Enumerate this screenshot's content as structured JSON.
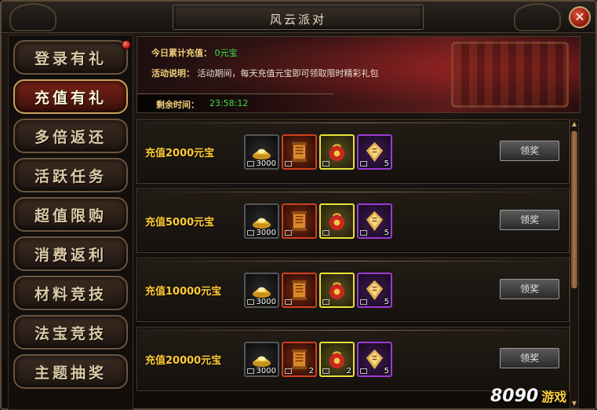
{
  "window": {
    "title": "风云派对",
    "close_symbol": "✕"
  },
  "menu": {
    "items": [
      {
        "label": "登录有礼",
        "active": false,
        "has_dot": true
      },
      {
        "label": "充值有礼",
        "active": true,
        "has_dot": false
      },
      {
        "label": "多倍返还",
        "active": false,
        "has_dot": false
      },
      {
        "label": "活跃任务",
        "active": false,
        "has_dot": false
      },
      {
        "label": "超值限购",
        "active": false,
        "has_dot": false
      },
      {
        "label": "消费返利",
        "active": false,
        "has_dot": false
      },
      {
        "label": "材料竞技",
        "active": false,
        "has_dot": false
      },
      {
        "label": "法宝竞技",
        "active": false,
        "has_dot": false
      },
      {
        "label": "主题抽奖",
        "active": false,
        "has_dot": false
      }
    ]
  },
  "banner": {
    "recharge_label": "今日累计充值：",
    "recharge_value": "0元宝",
    "desc_label": "活动说明：",
    "desc_text": "活动期间，每天充值元宝即可领取限时精彩礼包",
    "timer_label": "剩余时间：",
    "timer_value": "23:58:12"
  },
  "rewards": [
    {
      "label": "充值2000元宝",
      "claim_label": "领奖",
      "items": [
        {
          "icon": "gold-ingot-icon",
          "rarity": "gray",
          "qty": "3000"
        },
        {
          "icon": "scroll-icon",
          "rarity": "red",
          "qty": ""
        },
        {
          "icon": "red-pouch-icon",
          "rarity": "yellow",
          "qty": ""
        },
        {
          "icon": "talisman-icon",
          "rarity": "purple",
          "qty": "5"
        }
      ]
    },
    {
      "label": "充值5000元宝",
      "claim_label": "领奖",
      "items": [
        {
          "icon": "gold-ingot-icon",
          "rarity": "gray",
          "qty": "3000"
        },
        {
          "icon": "scroll-icon",
          "rarity": "red",
          "qty": ""
        },
        {
          "icon": "red-pouch-icon",
          "rarity": "yellow",
          "qty": ""
        },
        {
          "icon": "talisman-icon",
          "rarity": "purple",
          "qty": "5"
        }
      ]
    },
    {
      "label": "充值10000元宝",
      "claim_label": "领奖",
      "items": [
        {
          "icon": "gold-ingot-icon",
          "rarity": "gray",
          "qty": "3000"
        },
        {
          "icon": "scroll-icon",
          "rarity": "red",
          "qty": ""
        },
        {
          "icon": "red-pouch-icon",
          "rarity": "yellow",
          "qty": ""
        },
        {
          "icon": "talisman-icon",
          "rarity": "purple",
          "qty": "5"
        }
      ]
    },
    {
      "label": "充值20000元宝",
      "claim_label": "领奖",
      "items": [
        {
          "icon": "gold-ingot-icon",
          "rarity": "gray",
          "qty": "3000"
        },
        {
          "icon": "scroll-icon",
          "rarity": "red",
          "qty": "2"
        },
        {
          "icon": "red-pouch-icon",
          "rarity": "yellow",
          "qty": "2"
        },
        {
          "icon": "talisman-icon",
          "rarity": "purple",
          "qty": "5"
        }
      ]
    }
  ],
  "watermark": {
    "num": "8090",
    "text": "游戏"
  },
  "colors": {
    "accent_gold": "#ffcc33",
    "timer_green": "#36e04a",
    "frame": "#5a4a35"
  }
}
